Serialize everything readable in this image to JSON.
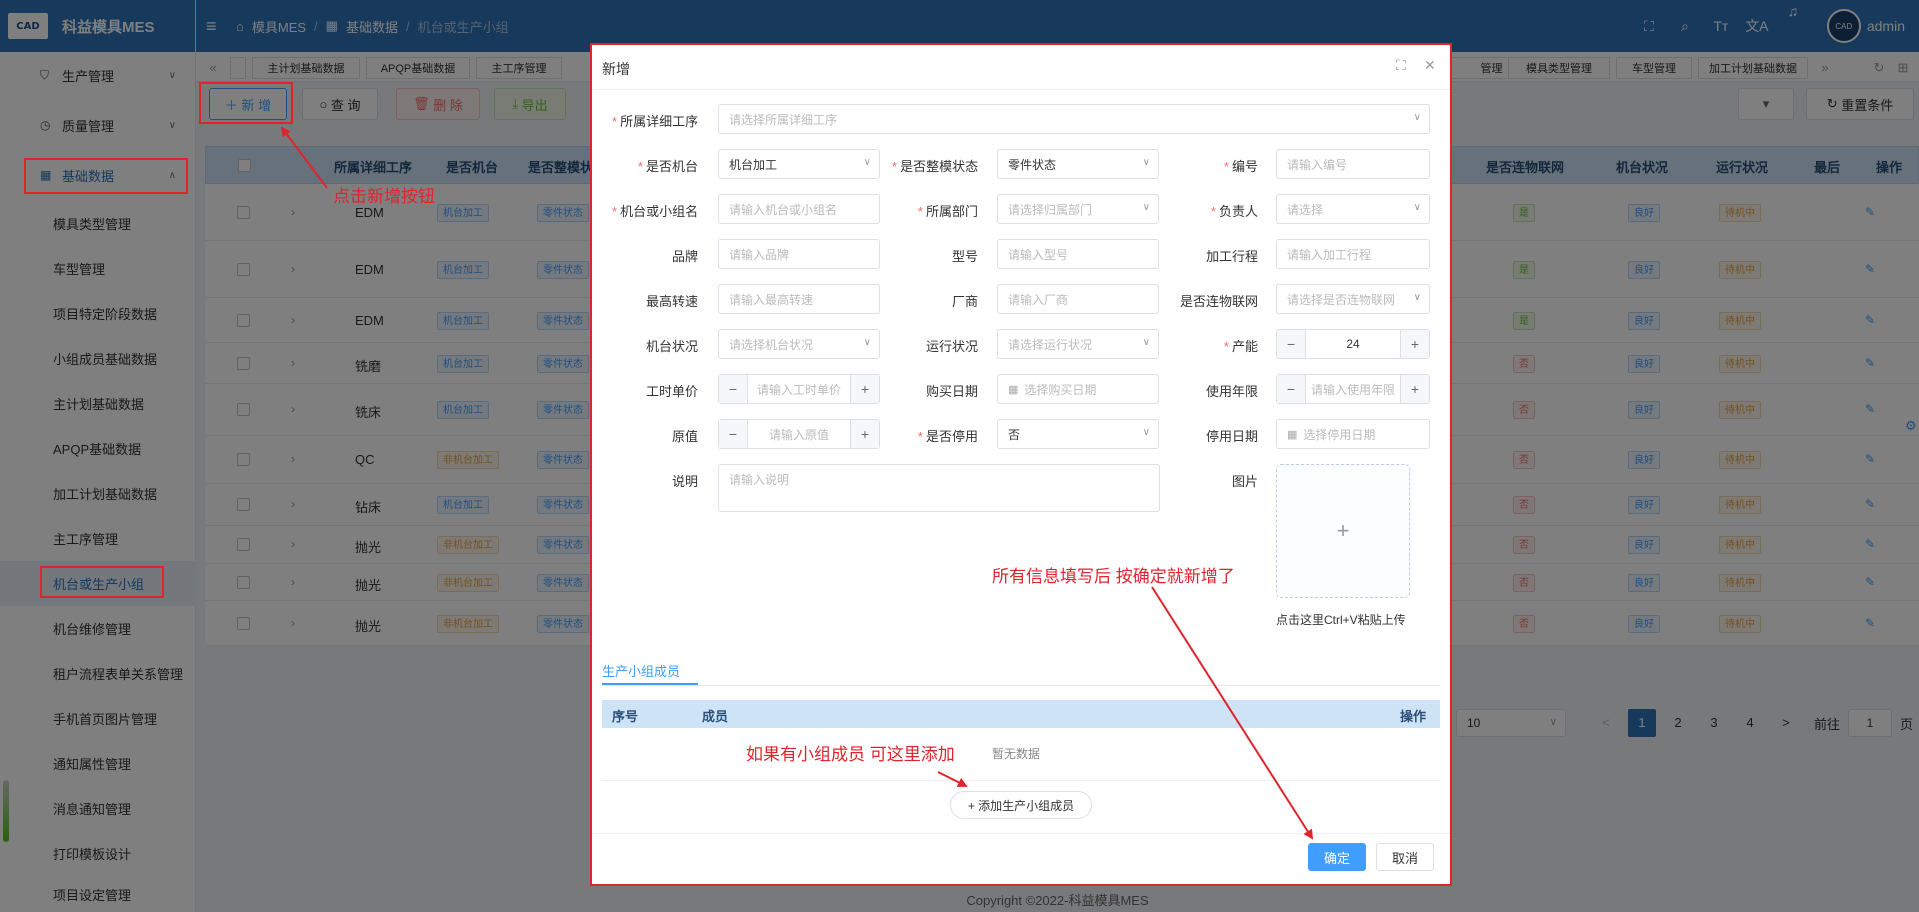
{
  "app": {
    "logo_badge": "CAD",
    "name": "科益模具MES",
    "user": "admin",
    "avatar": "CAD"
  },
  "breadcrumb": [
    "模具MES",
    "基础数据",
    "机台或生产小组"
  ],
  "sidebar": {
    "top_menus": [
      {
        "label": "生产管理"
      },
      {
        "label": "质量管理"
      },
      {
        "label": "基础数据"
      }
    ],
    "items": [
      {
        "label": "模具类型管理"
      },
      {
        "label": "车型管理"
      },
      {
        "label": "项目特定阶段数据"
      },
      {
        "label": "小组成员基础数据"
      },
      {
        "label": "主计划基础数据"
      },
      {
        "label": "APQP基础数据"
      },
      {
        "label": "加工计划基础数据"
      },
      {
        "label": "主工序管理"
      },
      {
        "label": "机台或生产小组"
      },
      {
        "label": "机台维修管理"
      },
      {
        "label": "租户流程表单关系管理"
      },
      {
        "label": "手机首页图片管理"
      },
      {
        "label": "通知属性管理"
      },
      {
        "label": "消息通知管理"
      },
      {
        "label": "打印模板设计"
      },
      {
        "label": "项目设定管理"
      }
    ]
  },
  "tabs": {
    "left": [
      "«",
      "",
      "主计划基础数据",
      "APQP基础数据",
      "主工序管理"
    ],
    "right": [
      "管理",
      "模具类型管理",
      "车型管理",
      "加工计划基础数据",
      "»"
    ]
  },
  "toolbar": {
    "add": "新 增",
    "query": "查 询",
    "delete": "删 除",
    "export": "导出",
    "reset": "重置条件"
  },
  "table": {
    "headers_left": [
      "所属详细工序",
      "是否机台",
      "是否整模状"
    ],
    "headers_right": [
      "是否连物联网",
      "机台状况",
      "运行状况",
      "最后",
      "操作"
    ],
    "rows": [
      {
        "proc": "EDM",
        "machine": "机台加工",
        "state": "零件状态",
        "iot": "是",
        "cond": "良好",
        "run": "待机中"
      },
      {
        "proc": "EDM",
        "machine": "机台加工",
        "state": "零件状态",
        "iot": "是",
        "cond": "良好",
        "run": "待机中"
      },
      {
        "proc": "EDM",
        "machine": "机台加工",
        "state": "零件状态",
        "iot": "是",
        "cond": "良好",
        "run": "待机中"
      },
      {
        "proc": "铣磨",
        "machine": "机台加工",
        "state": "零件状态",
        "iot": "否",
        "cond": "良好",
        "run": "待机中"
      },
      {
        "proc": "铣床",
        "machine": "机台加工",
        "state": "零件状态",
        "iot": "否",
        "cond": "良好",
        "run": "待机中"
      },
      {
        "proc": "QC",
        "machine": "非机台加工",
        "state": "零件状态",
        "iot": "否",
        "cond": "良好",
        "run": "待机中"
      },
      {
        "proc": "钻床",
        "machine": "机台加工",
        "state": "零件状态",
        "iot": "否",
        "cond": "良好",
        "run": "待机中"
      },
      {
        "proc": "抛光",
        "machine": "非机台加工",
        "state": "零件状态",
        "iot": "否",
        "cond": "良好",
        "run": "待机中"
      },
      {
        "proc": "抛光",
        "machine": "非机台加工",
        "state": "零件状态",
        "iot": "否",
        "cond": "良好",
        "run": "待机中"
      },
      {
        "proc": "抛光",
        "machine": "非机台加工",
        "state": "零件状态",
        "iot": "否",
        "cond": "良好",
        "run": "待机中"
      }
    ]
  },
  "pagination": {
    "page_size": "10",
    "pages": [
      "1",
      "2",
      "3",
      "4"
    ],
    "current": "1",
    "goto_label": "前往",
    "goto_value": "1",
    "page_suffix": "页"
  },
  "footer": "Copyright ©2022-科益模具MES",
  "dialog": {
    "title": "新增",
    "fields": {
      "detail_process": {
        "label": "所属详细工序",
        "placeholder": "请选择所属详细工序"
      },
      "is_machine": {
        "label": "是否机台",
        "value": "机台加工"
      },
      "whole_mold": {
        "label": "是否整模状态",
        "value": "零件状态"
      },
      "code": {
        "label": "编号",
        "placeholder": "请输入编号"
      },
      "machine_group": {
        "label": "机台或小组名",
        "placeholder": "请输入机台或小组名"
      },
      "department": {
        "label": "所属部门",
        "placeholder": "请选择归属部门"
      },
      "owner": {
        "label": "负责人",
        "placeholder": "请选择"
      },
      "brand": {
        "label": "品牌",
        "placeholder": "请输入品牌"
      },
      "model": {
        "label": "型号",
        "placeholder": "请输入型号"
      },
      "stroke": {
        "label": "加工行程",
        "placeholder": "请输入加工行程"
      },
      "max_speed": {
        "label": "最高转速",
        "placeholder": "请输入最高转速"
      },
      "vendor": {
        "label": "厂商",
        "placeholder": "请输入厂商"
      },
      "iot": {
        "label": "是否连物联网",
        "placeholder": "请选择是否连物联网"
      },
      "machine_cond": {
        "label": "机台状况",
        "placeholder": "请选择机台状况"
      },
      "run_cond": {
        "label": "运行状况",
        "placeholder": "请选择运行状况"
      },
      "capacity": {
        "label": "产能",
        "value": "24"
      },
      "unit_price": {
        "label": "工时单价",
        "placeholder": "请输入工时单价"
      },
      "buy_date": {
        "label": "购买日期",
        "placeholder": "选择购买日期"
      },
      "years": {
        "label": "使用年限",
        "placeholder": "请输入使用年限"
      },
      "orig_value": {
        "label": "原值",
        "placeholder": "请输入原值"
      },
      "disabled": {
        "label": "是否停用",
        "value": "否"
      },
      "disable_date": {
        "label": "停用日期",
        "placeholder": "选择停用日期"
      },
      "remark": {
        "label": "说明",
        "placeholder": "请输入说明"
      },
      "image": {
        "label": "图片",
        "hint": "点击这里Ctrl+V粘贴上传"
      }
    },
    "members_tab": "生产小组成员",
    "members_headers": [
      "序号",
      "成员",
      "操作"
    ],
    "empty_text": "暂无数据",
    "add_member": "+ 添加生产小组成员",
    "confirm": "确定",
    "cancel": "取消"
  },
  "annotations": {
    "click_add": "点击新增按钮",
    "fill_confirm": "所有信息填写后 按确定就新增了",
    "add_members": "如果有小组成员 可这里添加"
  },
  "colors": {
    "brand": "#2d72b8",
    "annotation": "#e0242d",
    "primary": "#409eff"
  }
}
